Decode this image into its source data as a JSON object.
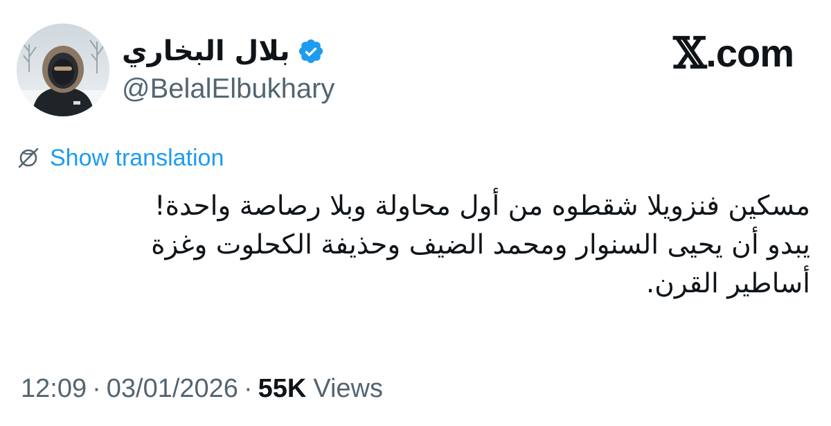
{
  "author": {
    "display_name": "بلال البخاري",
    "handle": "@BelalElbukhary",
    "verified": true,
    "avatar_icon": "profile-photo"
  },
  "brand": {
    "logo_mark": "𝕏",
    "logo_suffix": ".com"
  },
  "translation": {
    "label": "Show translation",
    "icon": "globe-translate-icon"
  },
  "tweet": {
    "lines": [
      "مسكين فنزويلا شقطوه من أول محاولة وبلا رصاصة واحدة!",
      "يبدو أن يحيى السنوار ومحمد الضيف وحذيفة الكحلوت وغزة",
      "أساطير القرن."
    ]
  },
  "meta": {
    "time": "12:09",
    "separator": "·",
    "date": "03/01/2026",
    "views_count": "55K",
    "views_label": "Views"
  },
  "colors": {
    "accent": "#1d9bf0",
    "verified": "#1d9bf0",
    "text_primary": "#0f1419",
    "text_secondary": "#536471",
    "background": "#ffffff"
  }
}
